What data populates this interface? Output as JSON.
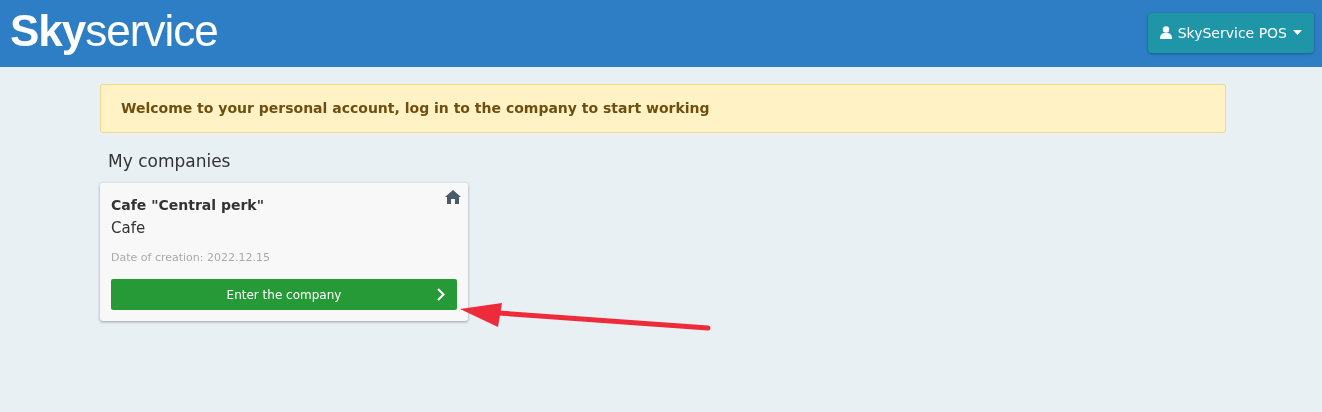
{
  "header": {
    "logo": "**Sky**service",
    "user_menu": {
      "label": "SkyService POS"
    }
  },
  "alert": {
    "text": "Welcome to your personal account, log in to the company to start working"
  },
  "section_title": "My companies",
  "companies": [
    {
      "name": "Cafe \"Central perk\"",
      "type": "Cafe",
      "created": "Date of creation: 2022.12.15",
      "button": "Enter the company"
    }
  ]
}
